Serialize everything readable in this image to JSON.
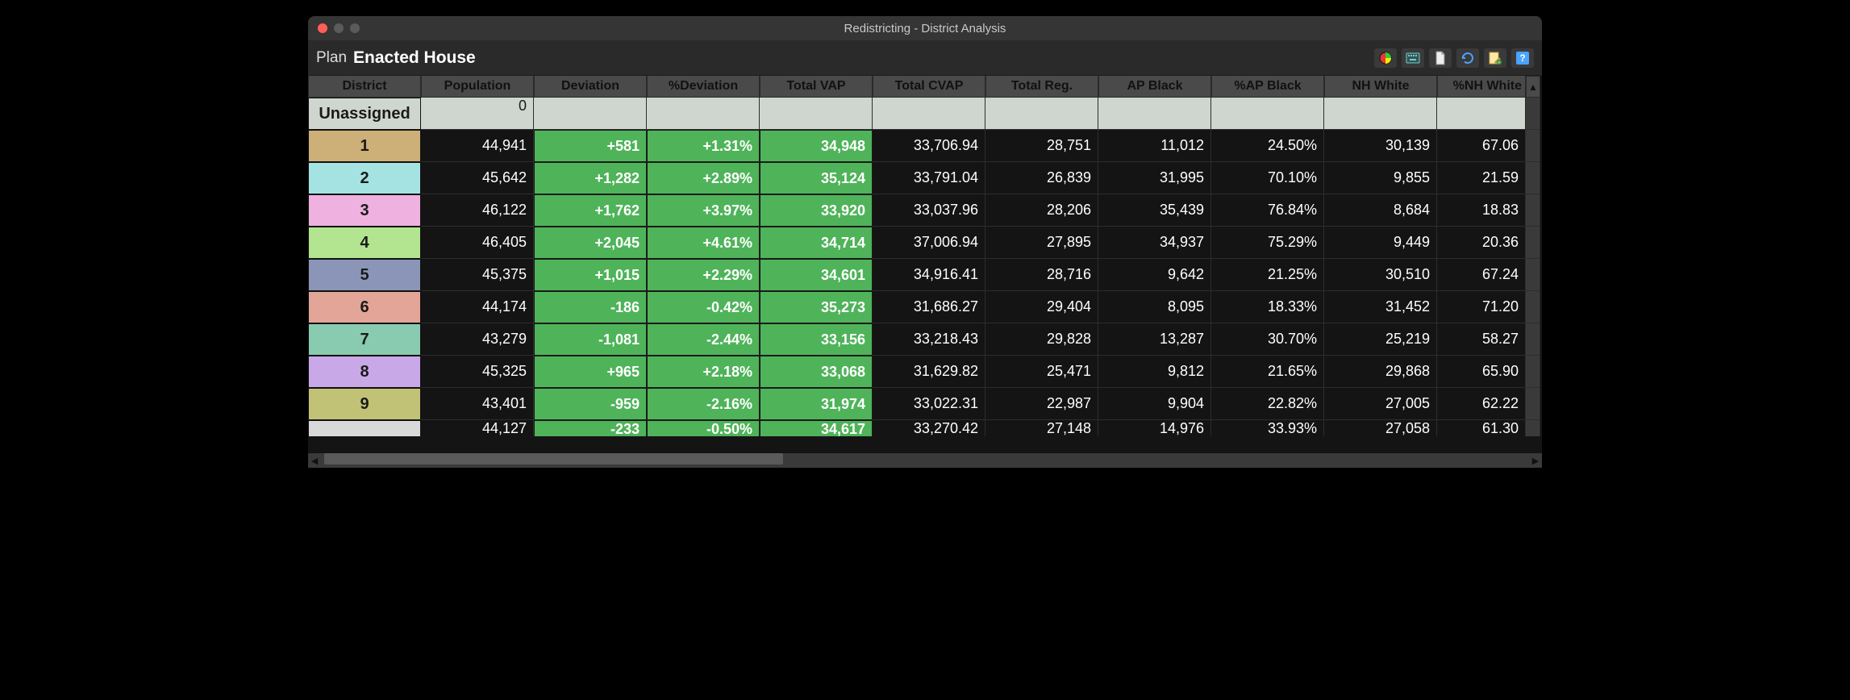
{
  "window": {
    "title": "Redistricting - District Analysis"
  },
  "toolbar": {
    "plan_label": "Plan",
    "plan_name": "Enacted House",
    "icons": [
      "pie-chart",
      "keyboard",
      "document",
      "refresh",
      "edit",
      "help"
    ]
  },
  "columns": [
    "District",
    "Population",
    "Deviation",
    "%Deviation",
    "Total VAP",
    "Total CVAP",
    "Total Reg.",
    "AP Black",
    "%AP Black",
    "NH White",
    "%NH White"
  ],
  "unassigned": {
    "label": "Unassigned",
    "population": "0"
  },
  "rows": [
    {
      "district": "1",
      "color": "#cdaf78",
      "population": "44,941",
      "deviation": "+581",
      "pct_deviation": "+1.31%",
      "total_vap": "34,948",
      "total_cvap": "33,706.94",
      "total_reg": "28,751",
      "ap_black": "11,012",
      "pct_ap_black": "24.50%",
      "nh_white": "30,139",
      "pct_nh_white": "67.06"
    },
    {
      "district": "2",
      "color": "#a5e3e3",
      "population": "45,642",
      "deviation": "+1,282",
      "pct_deviation": "+2.89%",
      "total_vap": "35,124",
      "total_cvap": "33,791.04",
      "total_reg": "26,839",
      "ap_black": "31,995",
      "pct_ap_black": "70.10%",
      "nh_white": "9,855",
      "pct_nh_white": "21.59"
    },
    {
      "district": "3",
      "color": "#efb1df",
      "population": "46,122",
      "deviation": "+1,762",
      "pct_deviation": "+3.97%",
      "total_vap": "33,920",
      "total_cvap": "33,037.96",
      "total_reg": "28,206",
      "ap_black": "35,439",
      "pct_ap_black": "76.84%",
      "nh_white": "8,684",
      "pct_nh_white": "18.83"
    },
    {
      "district": "4",
      "color": "#b3e48f",
      "population": "46,405",
      "deviation": "+2,045",
      "pct_deviation": "+4.61%",
      "total_vap": "34,714",
      "total_cvap": "37,006.94",
      "total_reg": "27,895",
      "ap_black": "34,937",
      "pct_ap_black": "75.29%",
      "nh_white": "9,449",
      "pct_nh_white": "20.36"
    },
    {
      "district": "5",
      "color": "#8b95b8",
      "population": "45,375",
      "deviation": "+1,015",
      "pct_deviation": "+2.29%",
      "total_vap": "34,601",
      "total_cvap": "34,916.41",
      "total_reg": "28,716",
      "ap_black": "9,642",
      "pct_ap_black": "21.25%",
      "nh_white": "30,510",
      "pct_nh_white": "67.24"
    },
    {
      "district": "6",
      "color": "#e2a598",
      "population": "44,174",
      "deviation": "-186",
      "pct_deviation": "-0.42%",
      "total_vap": "35,273",
      "total_cvap": "31,686.27",
      "total_reg": "29,404",
      "ap_black": "8,095",
      "pct_ap_black": "18.33%",
      "nh_white": "31,452",
      "pct_nh_white": "71.20"
    },
    {
      "district": "7",
      "color": "#89cbb0",
      "population": "43,279",
      "deviation": "-1,081",
      "pct_deviation": "-2.44%",
      "total_vap": "33,156",
      "total_cvap": "33,218.43",
      "total_reg": "29,828",
      "ap_black": "13,287",
      "pct_ap_black": "30.70%",
      "nh_white": "25,219",
      "pct_nh_white": "58.27"
    },
    {
      "district": "8",
      "color": "#c9a8e8",
      "population": "45,325",
      "deviation": "+965",
      "pct_deviation": "+2.18%",
      "total_vap": "33,068",
      "total_cvap": "31,629.82",
      "total_reg": "25,471",
      "ap_black": "9,812",
      "pct_ap_black": "21.65%",
      "nh_white": "29,868",
      "pct_nh_white": "65.90"
    },
    {
      "district": "9",
      "color": "#c2c277",
      "population": "43,401",
      "deviation": "-959",
      "pct_deviation": "-2.16%",
      "total_vap": "31,974",
      "total_cvap": "33,022.31",
      "total_reg": "22,987",
      "ap_black": "9,904",
      "pct_ap_black": "22.82%",
      "nh_white": "27,005",
      "pct_nh_white": "62.22"
    }
  ],
  "partial_row": {
    "district": "",
    "color": "#d9d9d9",
    "population": "44,127",
    "deviation": "-233",
    "pct_deviation": "-0.50%",
    "total_vap": "34,617",
    "total_cvap": "33,270.42",
    "total_reg": "27,148",
    "ap_black": "14,976",
    "pct_ap_black": "33.93%",
    "nh_white": "27,058",
    "pct_nh_white": "61.30"
  }
}
